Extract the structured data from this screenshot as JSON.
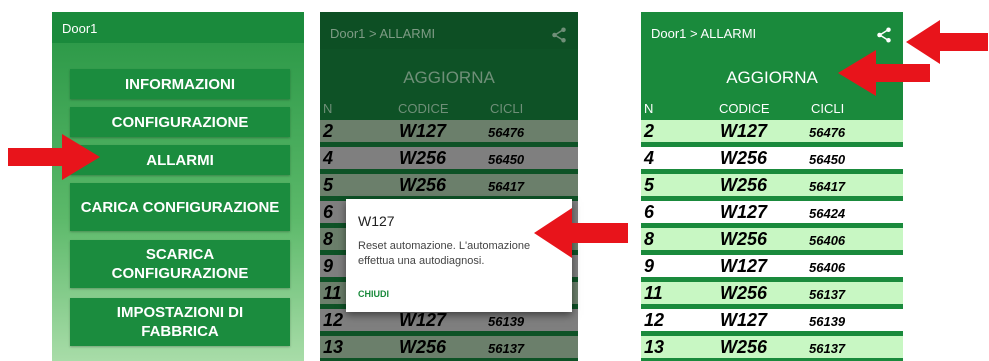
{
  "colors": {
    "green": "#1a8a3c",
    "light_row": "#c8f7c3",
    "arrow": "#e8141b"
  },
  "panel1": {
    "title": "Door1",
    "buttons": [
      {
        "label": "INFORMAZIONI"
      },
      {
        "label": "CONFIGURAZIONE"
      },
      {
        "label": "ALLARMI"
      },
      {
        "label": "CARICA CONFIGURAZIONE"
      },
      {
        "label": "SCARICA CONFIGURAZIONE"
      },
      {
        "label": "IMPOSTAZIONI DI FABBRICA"
      }
    ]
  },
  "alarms": {
    "title": "Door1 > ALLARMI",
    "refresh": "AGGIORNA",
    "headers": {
      "n": "N",
      "code": "CODICE",
      "cycles": "CICLI"
    },
    "rows": [
      {
        "n": "2",
        "code": "W127",
        "cycles": "56476"
      },
      {
        "n": "4",
        "code": "W256",
        "cycles": "56450"
      },
      {
        "n": "5",
        "code": "W256",
        "cycles": "56417"
      },
      {
        "n": "6",
        "code": "W127",
        "cycles": "56424"
      },
      {
        "n": "8",
        "code": "W256",
        "cycles": "56406"
      },
      {
        "n": "9",
        "code": "W127",
        "cycles": "56406"
      },
      {
        "n": "11",
        "code": "W256",
        "cycles": "56137"
      },
      {
        "n": "12",
        "code": "W127",
        "cycles": "56139"
      },
      {
        "n": "13",
        "code": "W256",
        "cycles": "56137"
      }
    ]
  },
  "dialog": {
    "title": "W127",
    "message": "Reset automazione. L'automazione effettua una autodiagnosi.",
    "button": "CHIUDI"
  },
  "icons": {
    "share": "share-icon",
    "arrow": "red-arrow-icon"
  }
}
